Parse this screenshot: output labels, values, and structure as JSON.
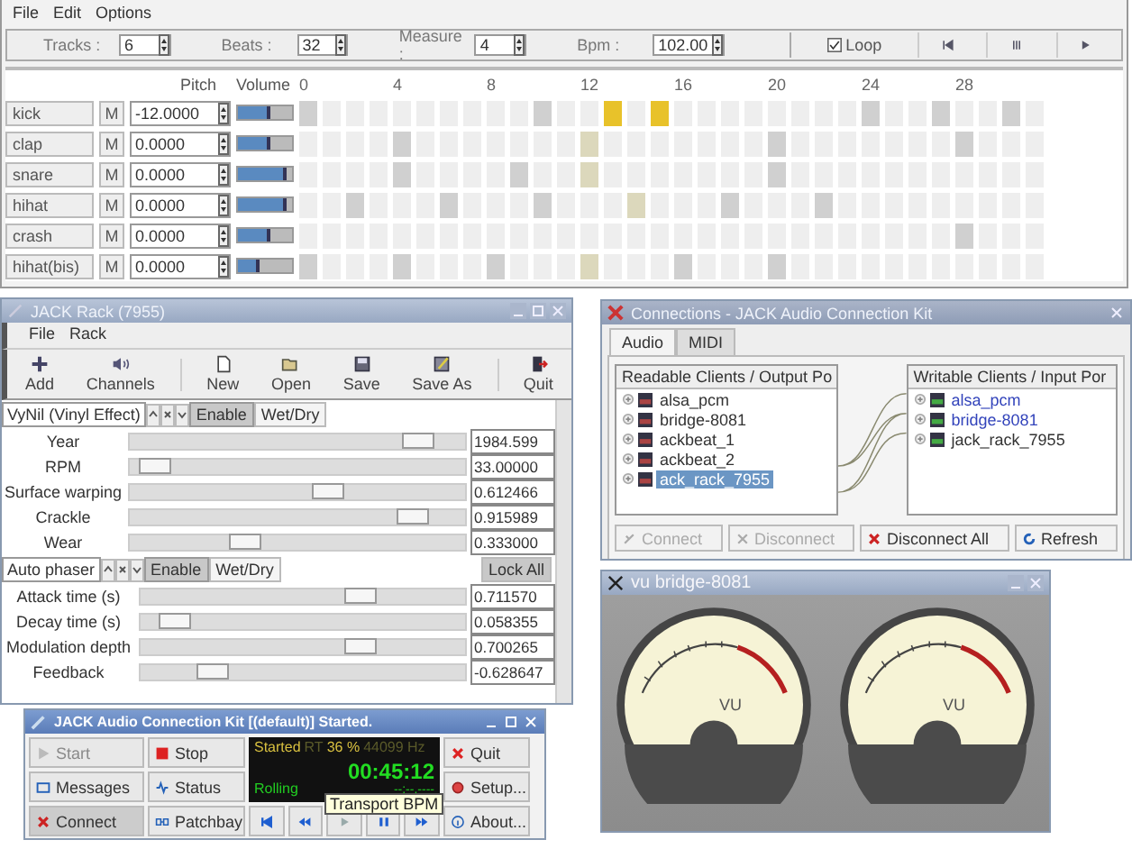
{
  "sequencer": {
    "menu": [
      "File",
      "Edit",
      "Options"
    ],
    "settings": [
      {
        "label": "Tracks :",
        "value": "6"
      },
      {
        "label": "Beats :",
        "value": "32"
      },
      {
        "label": "Measure :",
        "value": "4"
      },
      {
        "label": "Bpm :",
        "value": "102.00"
      }
    ],
    "loop": {
      "label": "Loop",
      "checked": true
    },
    "transport": [
      {
        "kind": "to-start"
      },
      {
        "kind": "stop"
      },
      {
        "kind": "play"
      }
    ],
    "pitch_header": "Pitch",
    "volume_header": "Volume",
    "beat_labels": [
      "0",
      "4",
      "8",
      "12",
      "16",
      "20",
      "24",
      "28"
    ],
    "tracks": [
      {
        "name": "kick",
        "mute": "M",
        "pitch": "-12.0000",
        "level": 0.6,
        "steps": [
          {
            "color": "#d0d0d0"
          },
          {
            "color": "#eeeeee"
          },
          {
            "color": "#eeeeee"
          },
          {
            "color": "#eeeeee"
          },
          {
            "color": "#eeeeee"
          },
          {
            "color": "#eeeeee"
          },
          {
            "color": "#eeeeee"
          },
          {
            "color": "#eeeeee"
          },
          {
            "color": "#eeeeee"
          },
          {
            "color": "#eeeeee"
          },
          {
            "color": "#d0d0d0"
          },
          {
            "color": "#eeeeee"
          },
          {
            "color": "#eeeeee"
          },
          {
            "color": "#e8c22a"
          },
          {
            "color": "#eeeeee"
          },
          {
            "color": "#e8c22a"
          },
          {
            "color": "#eeeeee"
          },
          {
            "color": "#eeeeee"
          },
          {
            "color": "#eeeeee"
          },
          {
            "color": "#eeeeee"
          },
          {
            "color": "#eeeeee"
          },
          {
            "color": "#eeeeee"
          },
          {
            "color": "#eeeeee"
          },
          {
            "color": "#eeeeee"
          },
          {
            "color": "#d0d0d0"
          },
          {
            "color": "#eeeeee"
          },
          {
            "color": "#eeeeee"
          },
          {
            "color": "#d0d0d0"
          },
          {
            "color": "#eeeeee"
          },
          {
            "color": "#eeeeee"
          },
          {
            "color": "#d0d0d0"
          },
          {
            "color": "#eeeeee"
          }
        ]
      },
      {
        "name": "clap",
        "mute": "M",
        "pitch": "0.0000",
        "level": 0.6,
        "steps": [
          {
            "color": "#eeeeee"
          },
          {
            "color": "#eeeeee"
          },
          {
            "color": "#eeeeee"
          },
          {
            "color": "#eeeeee"
          },
          {
            "color": "#d0d0d0"
          },
          {
            "color": "#eeeeee"
          },
          {
            "color": "#eeeeee"
          },
          {
            "color": "#eeeeee"
          },
          {
            "color": "#eeeeee"
          },
          {
            "color": "#eeeeee"
          },
          {
            "color": "#eeeeee"
          },
          {
            "color": "#eeeeee"
          },
          {
            "color": "#dcd8bc"
          },
          {
            "color": "#eeeeee"
          },
          {
            "color": "#eeeeee"
          },
          {
            "color": "#eeeeee"
          },
          {
            "color": "#eeeeee"
          },
          {
            "color": "#eeeeee"
          },
          {
            "color": "#eeeeee"
          },
          {
            "color": "#eeeeee"
          },
          {
            "color": "#d0d0d0"
          },
          {
            "color": "#eeeeee"
          },
          {
            "color": "#eeeeee"
          },
          {
            "color": "#eeeeee"
          },
          {
            "color": "#eeeeee"
          },
          {
            "color": "#eeeeee"
          },
          {
            "color": "#eeeeee"
          },
          {
            "color": "#eeeeee"
          },
          {
            "color": "#d0d0d0"
          },
          {
            "color": "#eeeeee"
          },
          {
            "color": "#eeeeee"
          },
          {
            "color": "#eeeeee"
          }
        ]
      },
      {
        "name": "snare",
        "mute": "M",
        "pitch": "0.0000",
        "level": 0.9,
        "steps": [
          {
            "color": "#eeeeee"
          },
          {
            "color": "#eeeeee"
          },
          {
            "color": "#eeeeee"
          },
          {
            "color": "#eeeeee"
          },
          {
            "color": "#d0d0d0"
          },
          {
            "color": "#eeeeee"
          },
          {
            "color": "#eeeeee"
          },
          {
            "color": "#eeeeee"
          },
          {
            "color": "#eeeeee"
          },
          {
            "color": "#d0d0d0"
          },
          {
            "color": "#eeeeee"
          },
          {
            "color": "#eeeeee"
          },
          {
            "color": "#dcd8bc"
          },
          {
            "color": "#eeeeee"
          },
          {
            "color": "#eeeeee"
          },
          {
            "color": "#eeeeee"
          },
          {
            "color": "#eeeeee"
          },
          {
            "color": "#eeeeee"
          },
          {
            "color": "#eeeeee"
          },
          {
            "color": "#eeeeee"
          },
          {
            "color": "#d0d0d0"
          },
          {
            "color": "#eeeeee"
          },
          {
            "color": "#eeeeee"
          },
          {
            "color": "#eeeeee"
          },
          {
            "color": "#eeeeee"
          },
          {
            "color": "#eeeeee"
          },
          {
            "color": "#eeeeee"
          },
          {
            "color": "#eeeeee"
          },
          {
            "color": "#eeeeee"
          },
          {
            "color": "#eeeeee"
          },
          {
            "color": "#eeeeee"
          },
          {
            "color": "#eeeeee"
          }
        ]
      },
      {
        "name": "hihat",
        "mute": "M",
        "pitch": "0.0000",
        "level": 0.9,
        "steps": [
          {
            "color": "#eeeeee"
          },
          {
            "color": "#eeeeee"
          },
          {
            "color": "#d0d0d0"
          },
          {
            "color": "#eeeeee"
          },
          {
            "color": "#eeeeee"
          },
          {
            "color": "#eeeeee"
          },
          {
            "color": "#d0d0d0"
          },
          {
            "color": "#eeeeee"
          },
          {
            "color": "#eeeeee"
          },
          {
            "color": "#eeeeee"
          },
          {
            "color": "#d0d0d0"
          },
          {
            "color": "#eeeeee"
          },
          {
            "color": "#eeeeee"
          },
          {
            "color": "#eeeeee"
          },
          {
            "color": "#dcd8bc"
          },
          {
            "color": "#eeeeee"
          },
          {
            "color": "#eeeeee"
          },
          {
            "color": "#eeeeee"
          },
          {
            "color": "#d0d0d0"
          },
          {
            "color": "#eeeeee"
          },
          {
            "color": "#eeeeee"
          },
          {
            "color": "#eeeeee"
          },
          {
            "color": "#d0d0d0"
          },
          {
            "color": "#eeeeee"
          },
          {
            "color": "#eeeeee"
          },
          {
            "color": "#eeeeee"
          },
          {
            "color": "#eeeeee"
          },
          {
            "color": "#eeeeee"
          },
          {
            "color": "#eeeeee"
          },
          {
            "color": "#eeeeee"
          },
          {
            "color": "#eeeeee"
          },
          {
            "color": "#eeeeee"
          }
        ]
      },
      {
        "name": "crash",
        "mute": "M",
        "pitch": "0.0000",
        "level": 0.6,
        "steps": [
          {
            "color": "#eeeeee"
          },
          {
            "color": "#eeeeee"
          },
          {
            "color": "#eeeeee"
          },
          {
            "color": "#eeeeee"
          },
          {
            "color": "#eeeeee"
          },
          {
            "color": "#eeeeee"
          },
          {
            "color": "#eeeeee"
          },
          {
            "color": "#eeeeee"
          },
          {
            "color": "#eeeeee"
          },
          {
            "color": "#eeeeee"
          },
          {
            "color": "#eeeeee"
          },
          {
            "color": "#eeeeee"
          },
          {
            "color": "#eeeeee"
          },
          {
            "color": "#eeeeee"
          },
          {
            "color": "#eeeeee"
          },
          {
            "color": "#eeeeee"
          },
          {
            "color": "#eeeeee"
          },
          {
            "color": "#eeeeee"
          },
          {
            "color": "#eeeeee"
          },
          {
            "color": "#eeeeee"
          },
          {
            "color": "#eeeeee"
          },
          {
            "color": "#eeeeee"
          },
          {
            "color": "#eeeeee"
          },
          {
            "color": "#eeeeee"
          },
          {
            "color": "#eeeeee"
          },
          {
            "color": "#eeeeee"
          },
          {
            "color": "#eeeeee"
          },
          {
            "color": "#eeeeee"
          },
          {
            "color": "#d0d0d0"
          },
          {
            "color": "#eeeeee"
          },
          {
            "color": "#eeeeee"
          },
          {
            "color": "#eeeeee"
          }
        ]
      },
      {
        "name": "hihat(bis)",
        "mute": "M",
        "pitch": "0.0000",
        "level": 0.4,
        "steps": [
          {
            "color": "#d0d0d0"
          },
          {
            "color": "#eeeeee"
          },
          {
            "color": "#eeeeee"
          },
          {
            "color": "#eeeeee"
          },
          {
            "color": "#d0d0d0"
          },
          {
            "color": "#eeeeee"
          },
          {
            "color": "#eeeeee"
          },
          {
            "color": "#eeeeee"
          },
          {
            "color": "#d0d0d0"
          },
          {
            "color": "#eeeeee"
          },
          {
            "color": "#eeeeee"
          },
          {
            "color": "#eeeeee"
          },
          {
            "color": "#dcd8bc"
          },
          {
            "color": "#eeeeee"
          },
          {
            "color": "#eeeeee"
          },
          {
            "color": "#eeeeee"
          },
          {
            "color": "#d0d0d0"
          },
          {
            "color": "#eeeeee"
          },
          {
            "color": "#eeeeee"
          },
          {
            "color": "#eeeeee"
          },
          {
            "color": "#d0d0d0"
          },
          {
            "color": "#eeeeee"
          },
          {
            "color": "#eeeeee"
          },
          {
            "color": "#eeeeee"
          },
          {
            "color": "#eeeeee"
          },
          {
            "color": "#eeeeee"
          },
          {
            "color": "#eeeeee"
          },
          {
            "color": "#eeeeee"
          },
          {
            "color": "#eeeeee"
          },
          {
            "color": "#eeeeee"
          },
          {
            "color": "#eeeeee"
          },
          {
            "color": "#eeeeee"
          }
        ]
      }
    ]
  },
  "jack_rack": {
    "title": "JACK Rack (7955)",
    "menu": [
      "File",
      "Rack"
    ],
    "toolbar": [
      {
        "kind": "add",
        "label": "Add"
      },
      {
        "kind": "channels",
        "label": "Channels"
      },
      {
        "kind": "new",
        "label": "New"
      },
      {
        "kind": "open",
        "label": "Open"
      },
      {
        "kind": "save",
        "label": "Save"
      },
      {
        "kind": "save-as",
        "label": "Save As"
      },
      {
        "kind": "quit",
        "label": "Quit"
      }
    ],
    "plugins": [
      {
        "name": "VyNil (Vinyl Effect)",
        "enable": "Enable",
        "enabled": true,
        "wet_dry": "Wet/Dry",
        "controls": [
          {
            "label": "Year",
            "level": 0.9,
            "value": "1984.599"
          },
          {
            "label": "RPM",
            "level": 0.03,
            "value": "33.00000"
          },
          {
            "label": "Surface warping",
            "level": 0.6,
            "value": "0.612466"
          },
          {
            "label": "Crackle",
            "level": 0.88,
            "value": "0.915989"
          },
          {
            "label": "Wear",
            "level": 0.33,
            "value": "0.333000"
          }
        ]
      },
      {
        "name": "Auto phaser",
        "enable": "Enable",
        "enabled": true,
        "wet_dry": "Wet/Dry",
        "lock_all": "Lock All",
        "controls": [
          {
            "label": "Attack time (s)",
            "level": 0.7,
            "value": "0.711570"
          },
          {
            "label": "Decay time (s)",
            "level": 0.06,
            "value": "0.058355"
          },
          {
            "label": "Modulation depth",
            "level": 0.7,
            "value": "0.700265"
          },
          {
            "label": "Feedback",
            "level": 0.19,
            "value": "-0.628647"
          }
        ]
      }
    ]
  },
  "connections": {
    "title": "Connections - JACK Audio Connection Kit",
    "tabs": [
      {
        "label": "Audio",
        "selected": true
      },
      {
        "label": "MIDI",
        "selected": false
      }
    ],
    "readable_header": "Readable Clients / Output Po",
    "readable": [
      {
        "name": "alsa_pcm",
        "selected": false
      },
      {
        "name": "bridge-8081",
        "selected": false
      },
      {
        "name": "ackbeat_1",
        "selected": false
      },
      {
        "name": "ackbeat_2",
        "selected": false
      },
      {
        "name": "ack_rack_7955",
        "selected": true
      }
    ],
    "writable_header": "Writable Clients / Input Por",
    "writable": [
      {
        "name": "alsa_pcm",
        "connected": true
      },
      {
        "name": "bridge-8081",
        "connected": true
      },
      {
        "name": "jack_rack_7955",
        "connected": false
      }
    ],
    "buttons": [
      {
        "kind": "connect",
        "label": "Connect",
        "disabled": true
      },
      {
        "kind": "disconnect",
        "label": "Disconnect",
        "disabled": true
      },
      {
        "kind": "disconnect-all",
        "label": "Disconnect All",
        "disabled": false
      },
      {
        "kind": "refresh",
        "label": "Refresh",
        "disabled": false
      }
    ]
  },
  "vu_window": {
    "title": "vu bridge-8081",
    "meters": [
      {
        "label": "VU"
      },
      {
        "label": "VU"
      }
    ]
  },
  "qjackctl": {
    "title": "JACK Audio Connection Kit [(default)] Started.",
    "left_buttons": [
      {
        "kind": "start",
        "label": "Start",
        "disabled": true
      },
      {
        "kind": "stop",
        "label": "Stop",
        "disabled": false
      },
      {
        "kind": "messages",
        "label": "Messages",
        "disabled": false
      },
      {
        "kind": "status",
        "label": "Status",
        "disabled": false
      },
      {
        "kind": "connect",
        "label": "Connect",
        "disabled": false
      },
      {
        "kind": "patchbay",
        "label": "Patchbay",
        "disabled": false
      }
    ],
    "display": {
      "state": "Started",
      "rt": "RT",
      "load": "36 %",
      "rate": "44099 Hz",
      "time": "00:45:12",
      "transport": "Rolling",
      "bbt": "--:--.----"
    },
    "transport": [
      {
        "kind": "to-start"
      },
      {
        "kind": "rewind"
      },
      {
        "kind": "play"
      },
      {
        "kind": "pause"
      },
      {
        "kind": "forward"
      }
    ],
    "right_buttons": [
      {
        "kind": "quit",
        "label": "Quit"
      },
      {
        "kind": "setup",
        "label": "Setup..."
      },
      {
        "kind": "about",
        "label": "About..."
      }
    ],
    "tooltip": "Transport BPM"
  }
}
